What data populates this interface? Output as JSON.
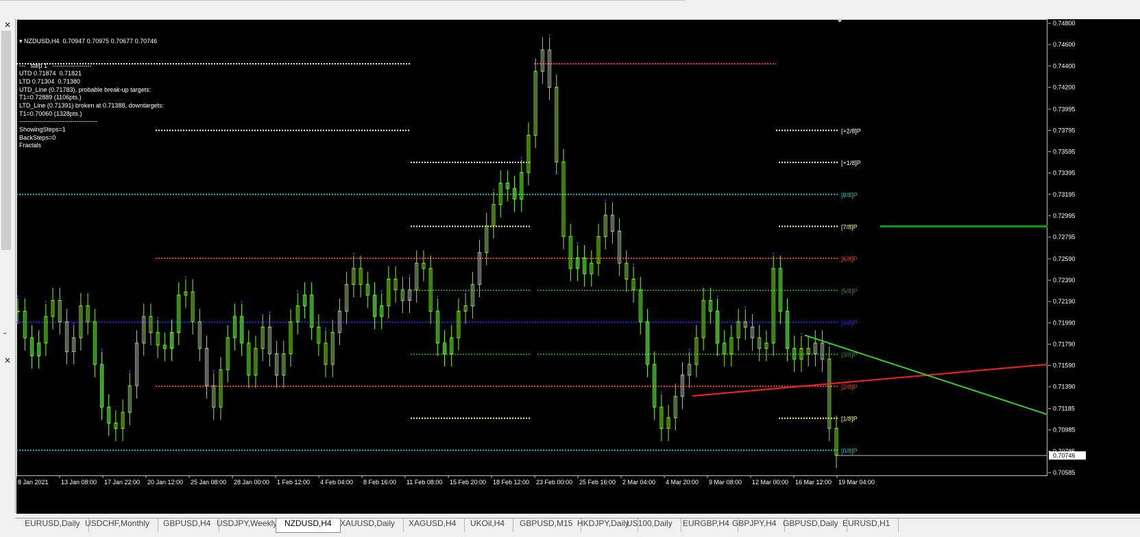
{
  "window": {
    "symbol_line": "NZDUSD,H4  0.70947 0.70975 0.70677 0.70746"
  },
  "info": [
    "---   step 1   -------------------",
    "UTD 0.71874  0.71821",
    "LTD 0.71304  0.71380",
    "UTD_Line (0.71783), probable break-up targets:",
    "T1=0.72889 (1106pts.)",
    "LTD_Line (0.71391) broken at 0.71388, downtargets:",
    "T1=0.70060 (1328pts.)",
    "--------------------------------------",
    "ShowingSteps=1",
    "BackSteps=0",
    "Fractals"
  ],
  "price_axis": [
    "0.74800",
    "0.74600",
    "0.74400",
    "0.74200",
    "0.73995",
    "0.73795",
    "0.73595",
    "0.73395",
    "0.73195",
    "0.72995",
    "0.72795",
    "0.72590",
    "0.72390",
    "0.72190",
    "0.71990",
    "0.71790",
    "0.71590",
    "0.71390",
    "0.71185",
    "0.70985",
    "0.70785",
    "0.70585"
  ],
  "current_price": "0.70746",
  "time_axis": [
    "8 Jan 2021",
    "13 Jan 08:00",
    "17 Jan 22:00",
    "20 Jan 12:00",
    "25 Jan 08:00",
    "28 Jan 00:00",
    "1 Feb 12:00",
    "4 Feb 04:00",
    "8 Feb 16:00",
    "11 Feb 08:00",
    "15 Feb 20:00",
    "18 Feb 12:00",
    "23 Feb 00:00",
    "25 Feb 16:00",
    "2 Mar 04:00",
    "4 Mar 20:00",
    "9 Mar 08:00",
    "12 Mar 00:00",
    "16 Mar 12:00",
    "19 Mar 04:00"
  ],
  "murrey": [
    {
      "label": "[+2/8]P",
      "color": "#ffffff",
      "price": 0.73795
    },
    {
      "label": "[+1/8]P",
      "color": "#ffffff",
      "price": 0.73495
    },
    {
      "label": "[8/8]P",
      "color": "#00c8c8",
      "price": 0.73195
    },
    {
      "label": "[7/8]P",
      "color": "#ffff66",
      "price": 0.72895
    },
    {
      "label": "[6/8]P",
      "color": "#ff3030",
      "price": 0.72595
    },
    {
      "label": "[5/8]P",
      "color": "#2e8b2e",
      "price": 0.72295
    },
    {
      "label": "[4/8]P",
      "color": "#2a2aff",
      "price": 0.71995
    },
    {
      "label": "[3/8]P",
      "color": "#2e8b2e",
      "price": 0.71695
    },
    {
      "label": "[2/8]P",
      "color": "#ff3030",
      "price": 0.71395
    },
    {
      "label": "[1/8]P",
      "color": "#ffff66",
      "price": 0.71095
    },
    {
      "label": "[0/8]P",
      "color": "#00c8c8",
      "price": 0.70795
    }
  ],
  "tabs": [
    "EURUSD,Daily",
    "USDCHF,Monthly",
    "GBPUSD,H4",
    "USDJPY,Weekly",
    "NZDUSD,H4",
    "XAUUSD,Daily",
    "XAGUSD,H4",
    "UKOil,H4",
    "GBPUSD,M15",
    "HKDJPY,Daily",
    "US100,Daily",
    "EURGBP,H4",
    "GBPJPY,H4",
    "GBPUSD,Daily",
    "EURUSD,H1"
  ],
  "active_tab": "NZDUSD,H4",
  "chart_data": {
    "type": "line",
    "series": [
      {
        "name": "NZDUSD,H4",
        "values": [
          0.721,
          0.7185,
          0.7168,
          0.718,
          0.7205,
          0.722,
          0.72,
          0.7172,
          0.7185,
          0.7215,
          0.72,
          0.716,
          0.712,
          0.7105,
          0.71,
          0.7115,
          0.714,
          0.718,
          0.7205,
          0.719,
          0.7178,
          0.7175,
          0.719,
          0.7225,
          0.7228,
          0.72,
          0.7175,
          0.714,
          0.712,
          0.7155,
          0.7185,
          0.7205,
          0.718,
          0.715,
          0.7175,
          0.7195,
          0.717,
          0.715,
          0.717,
          0.72,
          0.7215,
          0.7225,
          0.7195,
          0.718,
          0.716,
          0.719,
          0.721,
          0.7235,
          0.725,
          0.7235,
          0.7225,
          0.7205,
          0.7215,
          0.724,
          0.723,
          0.722,
          0.723,
          0.7255,
          0.725,
          0.721,
          0.718,
          0.717,
          0.7185,
          0.721,
          0.7215,
          0.7235,
          0.7265,
          0.729,
          0.731,
          0.733,
          0.7325,
          0.7315,
          0.734,
          0.7375,
          0.7435,
          0.7455,
          0.742,
          0.735,
          0.728,
          0.725,
          0.726,
          0.7245,
          0.7255,
          0.728,
          0.73,
          0.7285,
          0.7255,
          0.724,
          0.723,
          0.72,
          0.716,
          0.712,
          0.71,
          0.711,
          0.713,
          0.715,
          0.716,
          0.7185,
          0.722,
          0.721,
          0.718,
          0.717,
          0.7185,
          0.72,
          0.7195,
          0.7185,
          0.7175,
          0.718,
          0.725,
          0.721,
          0.7175,
          0.7165,
          0.7175,
          0.717,
          0.718,
          0.7165,
          0.71,
          0.7075
        ]
      }
    ],
    "ylim": [
      0.70585,
      0.748
    ]
  }
}
